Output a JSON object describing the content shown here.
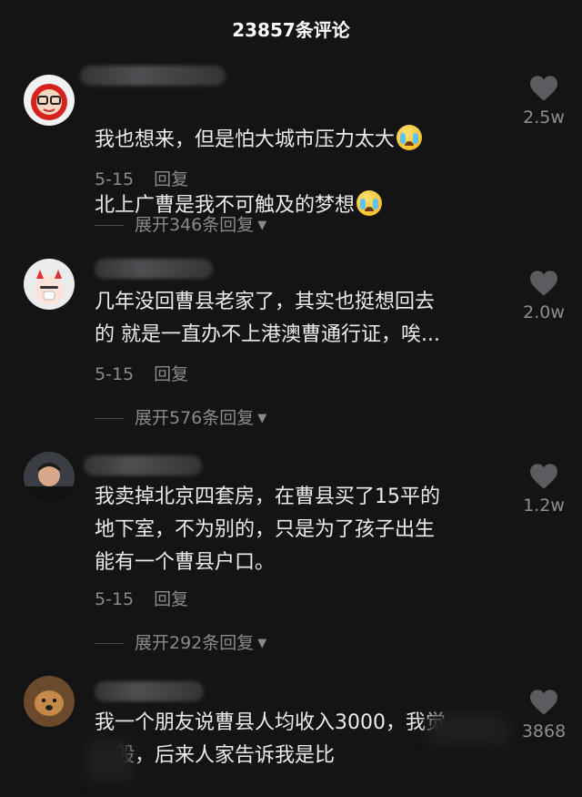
{
  "header": {
    "title": "23857条评论"
  },
  "comments": [
    {
      "text_line1": "我也想来，但是怕大城市压力太大",
      "text_line2": "北上广曹是我不可触及的梦想",
      "date": "5-15",
      "reply_label": "回复",
      "expand_label": "展开346条回复",
      "likes": "2.5w"
    },
    {
      "text": "几年没回曹县老家了，其实也挺想回去\n的 就是一直办不上港澳曹通行证，唉...",
      "date": "5-15",
      "reply_label": "回复",
      "expand_label": "展开576条回复",
      "likes": "2.0w"
    },
    {
      "text": "我卖掉北京四套房，在曹县买了15平的\n地下室，不为别的，只是为了孩子出生\n能有一个曹县户口。",
      "date": "5-15",
      "reply_label": "回复",
      "expand_label": "展开292条回复",
      "likes": "1.2w"
    },
    {
      "text": "我一个朋友说曹县人均收入3000，我觉\n一般，后来人家告诉我是比",
      "likes": "3868"
    }
  ],
  "colors": {
    "background": "#141414",
    "text": "#ececec",
    "muted": "#8a8a8e"
  }
}
